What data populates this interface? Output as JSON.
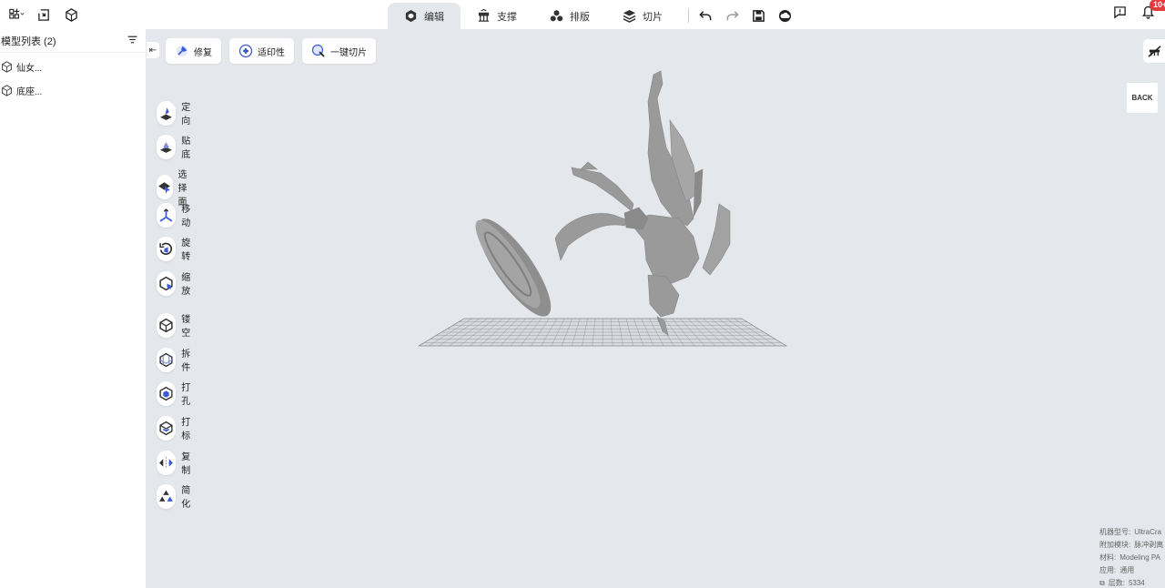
{
  "topbar": {
    "left_icons": [
      "add-model-icon",
      "import-icon",
      "model-library-icon"
    ],
    "tabs": [
      {
        "label": "编辑",
        "icon": "edit-cube-icon",
        "active": true
      },
      {
        "label": "支撑",
        "icon": "support-icon",
        "active": false
      },
      {
        "label": "排版",
        "icon": "layout-icon",
        "active": false
      },
      {
        "label": "切片",
        "icon": "slice-icon",
        "active": false
      }
    ],
    "actions": [
      "undo-icon",
      "redo-icon",
      "save-icon",
      "cloud-icon"
    ],
    "right": {
      "feedback_icon": "feedback-icon",
      "notification_icon": "bell-icon",
      "notification_badge": "10+"
    }
  },
  "model_list": {
    "title": "模型列表 (2)",
    "filter_icon": "filter-icon",
    "items": [
      {
        "label": "仙女..."
      },
      {
        "label": "底座..."
      }
    ]
  },
  "quickbar": [
    {
      "label": "修复",
      "icon": "repair-icon"
    },
    {
      "label": "适印性",
      "icon": "printability-icon"
    },
    {
      "label": "一键切片",
      "icon": "one-click-slice-icon"
    }
  ],
  "tools": [
    {
      "label": "定向",
      "icon": "orient-icon"
    },
    {
      "label": "贴底",
      "icon": "lay-flat-icon"
    },
    {
      "label": "选择面",
      "icon": "select-face-icon"
    },
    {
      "label": "移动",
      "icon": "move-icon"
    },
    {
      "label": "旋转",
      "icon": "rotate-icon"
    },
    {
      "label": "缩放",
      "icon": "scale-icon"
    },
    {
      "label": "镂空",
      "icon": "hollow-icon"
    },
    {
      "label": "拆件",
      "icon": "split-icon"
    },
    {
      "label": "打孔",
      "icon": "punch-hole-icon"
    },
    {
      "label": "打标",
      "icon": "label-icon"
    },
    {
      "label": "复制",
      "icon": "copy-icon"
    },
    {
      "label": "简化",
      "icon": "simplify-icon"
    }
  ],
  "view_cube": {
    "label": "BACK"
  },
  "machine_info": [
    {
      "key": "机器型号:",
      "value": "UltraCra"
    },
    {
      "key": "附加模块:",
      "value": "脉冲剥离"
    },
    {
      "key": "材料:",
      "value": "Modeling PA"
    },
    {
      "key": "应用:",
      "value": "通用"
    },
    {
      "key": "层数:",
      "value": "5334"
    }
  ],
  "colors": {
    "accent": "#4a6cf7",
    "badge": "#e23b3b",
    "viewport": "#e4e7eb",
    "model": "#9a9a9a"
  }
}
